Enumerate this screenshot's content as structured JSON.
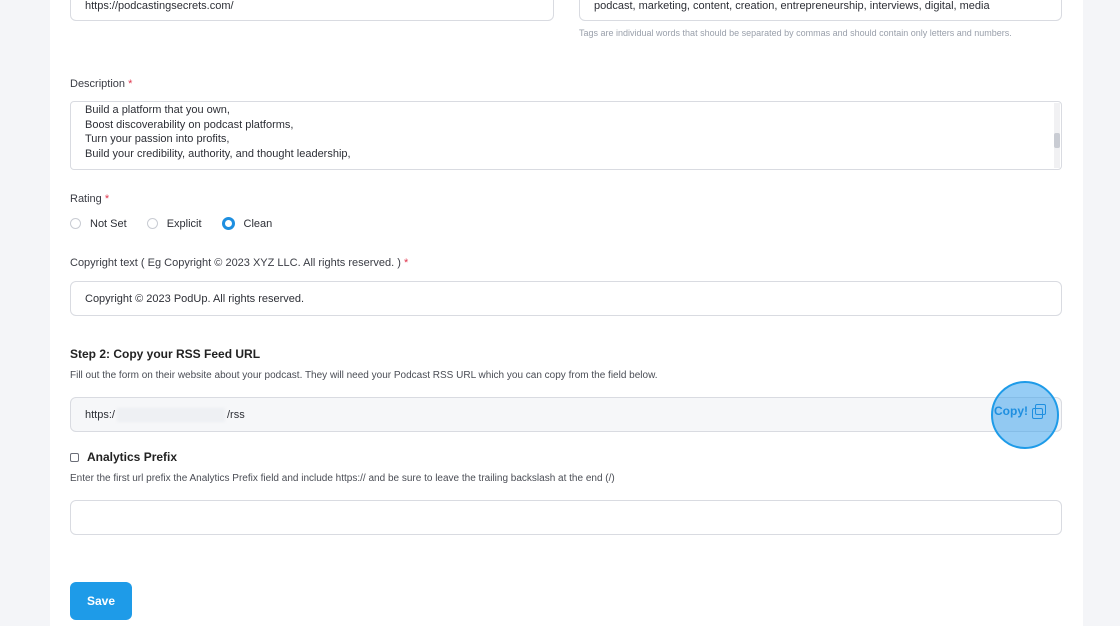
{
  "website_field": {
    "value": "https://podcastingsecrets.com/"
  },
  "tags_field": {
    "value": "podcast, marketing, content, creation, entrepreneurship, interviews, digital, media",
    "hint": "Tags are individual words that should be separated by commas and should contain only letters and numbers."
  },
  "description": {
    "label": "Description",
    "required_mark": "*",
    "lines": [
      "Build a platform that you own,",
      "Boost discoverability on podcast platforms,",
      "Turn your passion into profits,",
      "Build your credibility, authority, and thought leadership,"
    ]
  },
  "rating": {
    "label": "Rating",
    "required_mark": "*",
    "options": [
      "Not Set",
      "Explicit",
      "Clean"
    ],
    "selected": "Clean"
  },
  "copyright": {
    "label": "Copyright text ( Eg Copyright © 2023 XYZ LLC. All rights reserved. )",
    "required_mark": "*",
    "value": "Copyright © 2023 PodUp. All rights reserved."
  },
  "step2": {
    "title": "Step 2: Copy your RSS Feed URL",
    "subtitle": "Fill out the form on their website about your podcast. They will need your Podcast RSS URL which you can copy from the field below.",
    "rss_prefix": "https:/",
    "rss_suffix": "/rss",
    "copy_label": "Copy!"
  },
  "analytics": {
    "label": "Analytics Prefix",
    "hint": "Enter the first url prefix the Analytics Prefix field and include https:// and be sure to leave the trailing backslash at the end (/)",
    "value": ""
  },
  "save_label": "Save",
  "colors": {
    "accent": "#1e9be8",
    "required": "#e0364d"
  }
}
